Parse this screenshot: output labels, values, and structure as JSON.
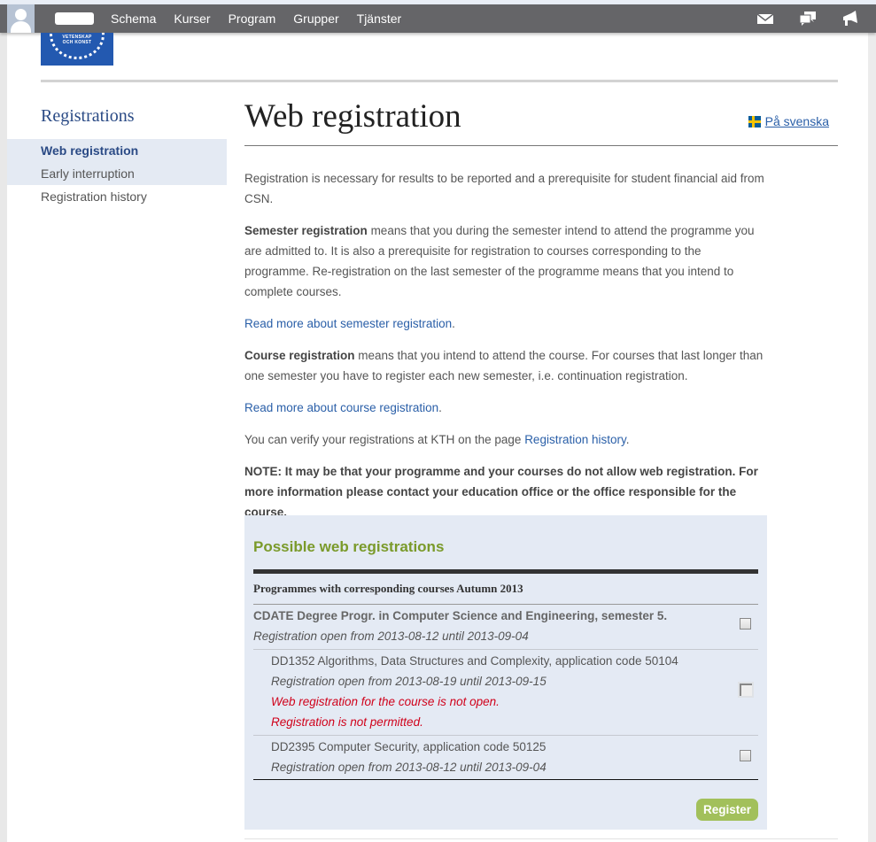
{
  "navbar": {
    "links": [
      "Schema",
      "Kurser",
      "Program",
      "Grupper",
      "Tjänster"
    ],
    "icons": [
      "mail-icon",
      "chat-icon",
      "megaphone-icon"
    ]
  },
  "logo": {
    "text_line1": "VETENSKAP",
    "text_line2": "OCH KONST"
  },
  "sidebar": {
    "heading": "Registrations",
    "items": [
      {
        "label": "Web registration",
        "active": true
      },
      {
        "label": "Early interruption",
        "active": false
      },
      {
        "label": "Registration history",
        "active": false
      }
    ]
  },
  "main": {
    "title": "Web registration",
    "language_link": "På svenska",
    "p1": "Registration is necessary for results to be reported and a prerequisite for student financial aid from CSN.",
    "p2_bold": "Semester registration",
    "p2_rest": " means that you during the semester intend to attend the programme you are admitted to. It is also a prerequisite for registration to courses corresponding to the programme. Re-registration on the last semester of the programme means that you intend to complete courses.",
    "link_semester": "Read more about semester registration",
    "p3_bold": "Course registration",
    "p3_rest": " means that you intend to attend the course. For courses that last longer than one semester you have to register each new semester, i.e. continuation registration.",
    "link_course": "Read more about course registration",
    "p4_text": "You can verify your registrations at KTH on the page ",
    "p4_link": "Registration history",
    "note": "NOTE: It may be that your programme and your courses do not allow web registration. For more information please contact your education office or the office responsible for the course.",
    "period": "."
  },
  "registrations": {
    "heading": "Possible web registrations",
    "subheading": "Programmes with corresponding courses Autumn 2013",
    "programme": {
      "name": "CDATE Degree Progr. in Computer Science and Engineering, semester 5.",
      "open": "Registration open from 2013-08-12 until 2013-09-04",
      "checked": false
    },
    "courses": [
      {
        "name": "DD1352 Algorithms, Data Structures and Complexity, application code 50104",
        "open": "Registration open from 2013-08-19 until 2013-09-15",
        "errors": [
          "Web registration for the course is not open.",
          "Registration is not permitted."
        ],
        "checked": false,
        "disabled": true
      },
      {
        "name": "DD2395 Computer Security, application code 50125",
        "open": "Registration open from 2013-08-12 until 2013-09-04",
        "errors": [],
        "checked": false,
        "disabled": false
      }
    ],
    "register_button": "Register"
  },
  "colors": {
    "navbar": "#656568",
    "accent_blue": "#2a5fa8",
    "heading_green": "#7a9a2a",
    "button_green": "#a2c05b",
    "error_red": "#d0021b",
    "box_bg": "#e4eaf4"
  }
}
